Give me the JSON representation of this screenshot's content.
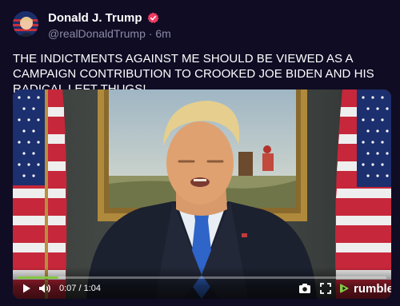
{
  "post": {
    "display_name": "Donald J. Trump",
    "handle": "@realDonaldTrump",
    "separator": "·",
    "age": "6m",
    "text": "THE INDICTMENTS AGAINST ME SHOULD BE VIEWED AS A CAMPAIGN CONTRIBUTION TO CROOKED JOE BIDEN AND HIS RADICAL LEFT THUGS!"
  },
  "video": {
    "current_time": "0:07",
    "duration": "1:04",
    "time_separator": " / ",
    "progress": 0.11,
    "provider": "rumble"
  },
  "colors": {
    "background": "#0f0c24",
    "verified": "#ef3b63",
    "progress": "#85c742",
    "muted_text": "#8b8aa6"
  },
  "icons": [
    "avatar",
    "verified-badge-icon",
    "play-icon",
    "volume-icon",
    "screenshot-icon",
    "fullscreen-icon",
    "rumble-logo-icon"
  ]
}
